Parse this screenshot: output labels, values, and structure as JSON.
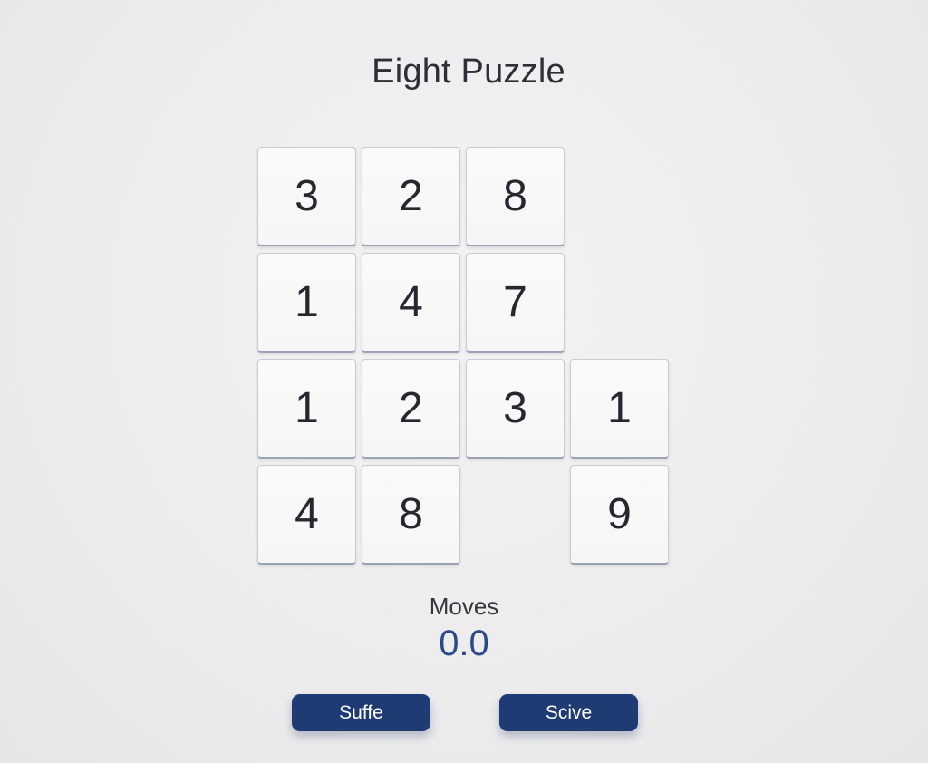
{
  "app": {
    "title": "Eight Puzzle"
  },
  "board": {
    "tiles": [
      {
        "row": 0,
        "col": 0,
        "label": "3"
      },
      {
        "row": 0,
        "col": 1,
        "label": "2"
      },
      {
        "row": 0,
        "col": 2,
        "label": "8"
      },
      {
        "row": 1,
        "col": 0,
        "label": "1"
      },
      {
        "row": 1,
        "col": 1,
        "label": "4"
      },
      {
        "row": 1,
        "col": 2,
        "label": "7"
      },
      {
        "row": 2,
        "col": 0,
        "label": "1"
      },
      {
        "row": 2,
        "col": 1,
        "label": "2"
      },
      {
        "row": 2,
        "col": 2,
        "label": "3"
      },
      {
        "row": 2,
        "col": 3,
        "label": "1"
      },
      {
        "row": 3,
        "col": 0,
        "label": "4"
      },
      {
        "row": 3,
        "col": 1,
        "label": "8"
      },
      {
        "row": 3,
        "col": 3,
        "label": "9"
      }
    ]
  },
  "stats": {
    "moves_label": "Moves",
    "moves_value": "0.0"
  },
  "controls": {
    "shuffle_label": "Suffe",
    "solve_label": "Scive"
  },
  "colors": {
    "accent": "#1f3b73",
    "moves_value": "#2d4a86",
    "background": "#ececed"
  }
}
